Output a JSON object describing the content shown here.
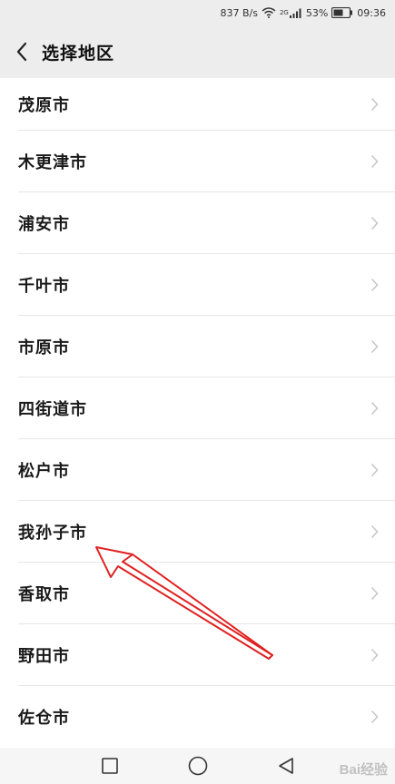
{
  "status_bar": {
    "speed": "837 B/s",
    "network": "2G",
    "battery_percent": "53%",
    "time": "09:36"
  },
  "nav": {
    "title": "选择地区",
    "back_icon": "chevron-left-icon"
  },
  "regions": [
    "茂原市",
    "木更津市",
    "浦安市",
    "千叶市",
    "市原市",
    "四街道市",
    "松户市",
    "我孙子市",
    "香取市",
    "野田市",
    "佐仓市"
  ],
  "bottom_nav": {
    "recent_icon": "square-icon",
    "home_icon": "circle-icon",
    "back_icon": "triangle-back-icon"
  },
  "watermark": "Bai经验",
  "colors": {
    "header_bg": "#ededed",
    "annotation": "#e02020",
    "chevron": "#c8c8c8"
  }
}
